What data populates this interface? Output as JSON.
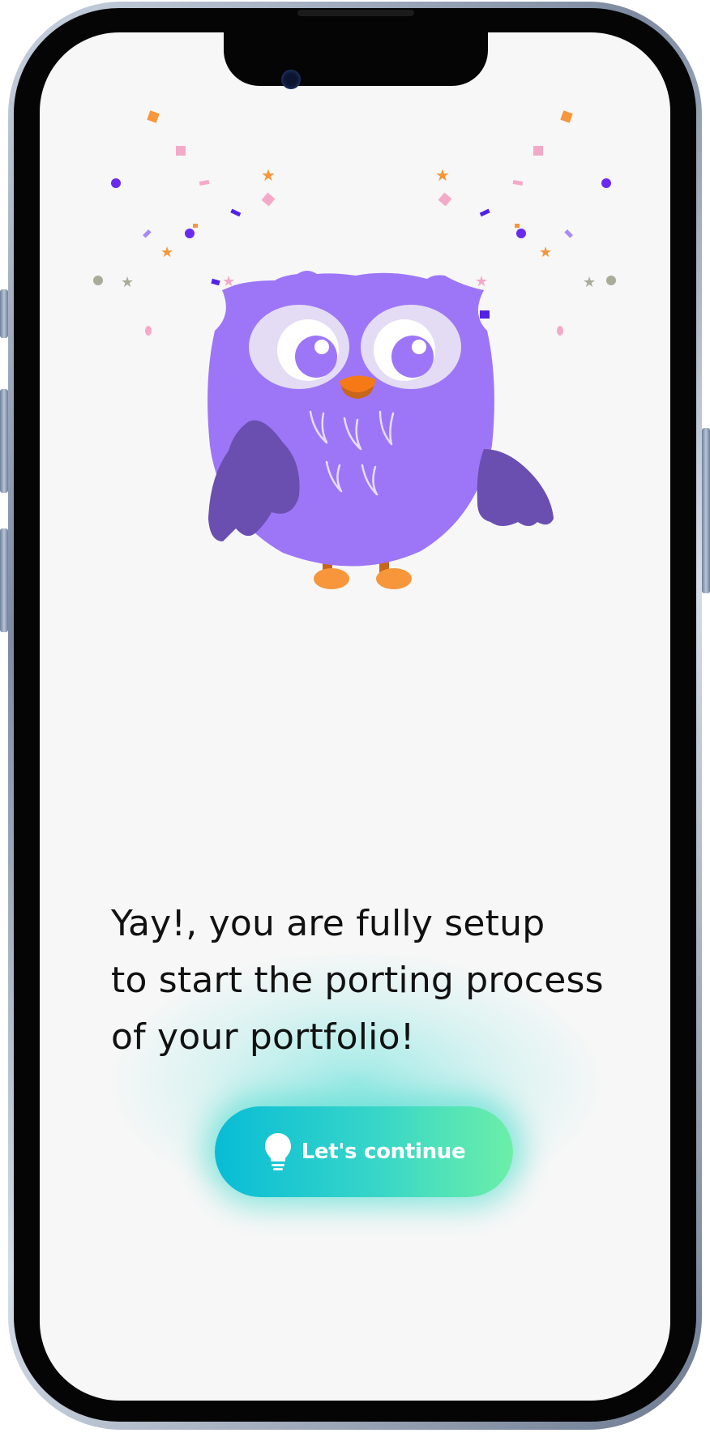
{
  "screen": {
    "message_lines": [
      "Yay!, you are fully setup",
      "to start the porting process",
      "of your portfolio!"
    ],
    "continue_button": {
      "label": "Let's continue",
      "icon": "lightbulb-icon"
    },
    "illustration": {
      "subject": "owl-mascot",
      "decoration": "confetti"
    }
  },
  "colors": {
    "owl_body": "#9d76f7",
    "owl_wing": "#6a4fb0",
    "owl_eye_ring": "#e3dcf4",
    "owl_beak": "#f57a16",
    "owl_feet": "#f7963a",
    "button_gradient": [
      "#08bcd6",
      "#38d6c8",
      "#6cefa8"
    ],
    "screen_background": "#f7f7f7",
    "text": "#111111"
  }
}
